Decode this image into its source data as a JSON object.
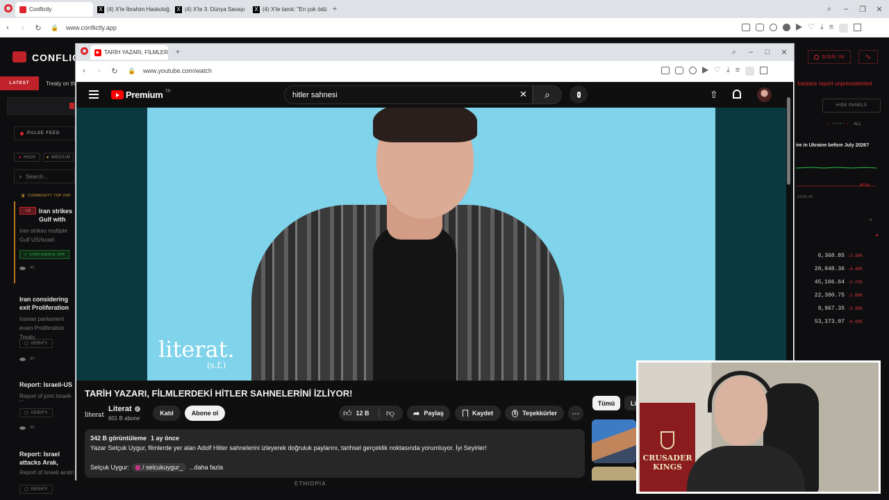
{
  "outer_browser": {
    "tabs": [
      {
        "label": "Conflictly",
        "icon": "conflictly-icon"
      },
      {
        "label": "(4) X'te İbrahim Haskoloğ",
        "icon": "x-icon"
      },
      {
        "label": "(4) X'te 3. Dünya Savaşı",
        "icon": "x-icon"
      },
      {
        "label": "(4) X'te tanık: \"En çok ödü",
        "icon": "x-icon"
      }
    ],
    "url": "www.conflictly.app"
  },
  "conflictly": {
    "brand": "CONFLICT",
    "latest_label": "LATEST",
    "latest_text": "Treaty on th",
    "sign_in": "SIGN IN",
    "right_ticker_text": "Iranians report unprecedented",
    "pulse_feed": "PULSE FEED",
    "filters": [
      "HIGH",
      "MEDIUM"
    ],
    "search_placeholder": "Search...",
    "community_label": "COMMUNITY TOP 24H",
    "hide_panels": "HIDE PANELS",
    "all_label": "ALL",
    "market_question": "ire in Ukraine before July 2026?",
    "market_value": "86.5%",
    "market_sign_in": "SIGN IN",
    "tickers": [
      {
        "value": "6,368.85",
        "change": "-3.38%"
      },
      {
        "value": "20,948.36",
        "change": "-4.48%"
      },
      {
        "value": "45,166.64",
        "change": "-2.72%"
      },
      {
        "value": "22,300.75",
        "change": "-2.86%"
      },
      {
        "value": "9,967.35",
        "change": "-3.38%"
      },
      {
        "value": "53,373.07",
        "change": "-0.43%"
      }
    ],
    "stories": [
      {
        "badge": "138",
        "title": "Iran strikes Gulf with US/Israel",
        "text": "Iran strikes multiple Gulf US/Israel.",
        "confidence": "CONFIDENCE 95%",
        "time": "4h"
      },
      {
        "title": "Iran considering exit Proliferation",
        "text": "Iranian parliament exam Proliferation Treaty.",
        "verify": "VERIFY",
        "time": "6h"
      },
      {
        "title": "Report: Israeli-US air",
        "text": "Report of joint Israeli-U",
        "verify": "VERIFY",
        "time": "4h"
      },
      {
        "title": "Report: Israel attacks Arak, Fordow",
        "text": "Report of Israeli airstri",
        "verify": "VERIFY"
      }
    ],
    "bottom_label": "ETHIOPIA"
  },
  "inner_browser": {
    "tab_title": "TARİH YAZARI, FİLMLERD",
    "url": "www.youtube.com/watch"
  },
  "youtube": {
    "logo_text": "Premium",
    "logo_region": "TR",
    "search_query": "hitler sahnesi",
    "video_watermark": "literat.",
    "video_watermark_sub": "(s.f.)",
    "title": "TARİH YAZARI, FİLMLERDEKİ HİTLER SAHNELERİNİ İZLİYOR!",
    "channel_name": "Literat",
    "channel_logo": "literat",
    "subscribers": "601 B abone",
    "join_label": "Katıl",
    "subscribe_label": "Abone ol",
    "likes": "12 B",
    "share_label": "Paylaş",
    "save_label": "Kaydet",
    "thanks_label": "Teşekkürler",
    "views": "342 B görüntüleme",
    "published": "1 ay önce",
    "description": "Yazar Selçuk Uygur, filmlerde yer alan Adolf Hitler sahnelerini izleyerek doğruluk paylarını, tarihsel gerçeklik noktasında yorumluyor. İyi Seyirler!",
    "desc_person": "Selçuk Uygur:",
    "desc_handle": "/ selcukuygur_",
    "more_label": "...daha fazla",
    "filter_chips": [
      "Tümü",
      "Lit"
    ]
  },
  "webcam": {
    "poster_text": [
      "CRUSADER",
      "KINGS"
    ]
  },
  "colors": {
    "accent_red": "#e0252c",
    "yt_bg": "#0f0f0f",
    "video_bg": "#7fd3ea"
  }
}
